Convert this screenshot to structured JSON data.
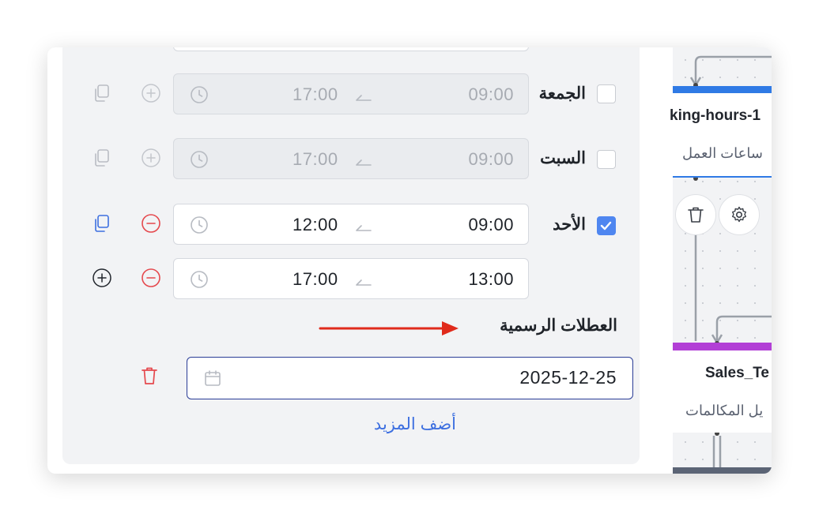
{
  "schedule": {
    "days": [
      {
        "label": "الجمعة",
        "checked": false,
        "ranges": [
          {
            "start": "09:00",
            "end": "17:00"
          }
        ]
      },
      {
        "label": "السبت",
        "checked": false,
        "ranges": [
          {
            "start": "09:00",
            "end": "17:00"
          }
        ]
      },
      {
        "label": "الأحد",
        "checked": true,
        "ranges": [
          {
            "start": "09:00",
            "end": "12:00"
          },
          {
            "start": "13:00",
            "end": "17:00"
          }
        ]
      }
    ]
  },
  "holidays": {
    "title": "العطلات الرسمية",
    "dates": [
      "2025-12-25"
    ],
    "add_more": "أضف المزيد"
  },
  "canvas": {
    "node1": {
      "title": "king-hours-1",
      "subtitle": "ساعات العمل",
      "bar_color": "#2f7ae5"
    },
    "node2": {
      "title": "Sales_Te",
      "subtitle": "يل المكالمات",
      "bar_color": "#b23fd6"
    }
  },
  "colors": {
    "accent": "#4f86f0",
    "danger": "#e5484d",
    "link": "#3d6fe0",
    "annotation_arrow": "#e02a1b"
  }
}
